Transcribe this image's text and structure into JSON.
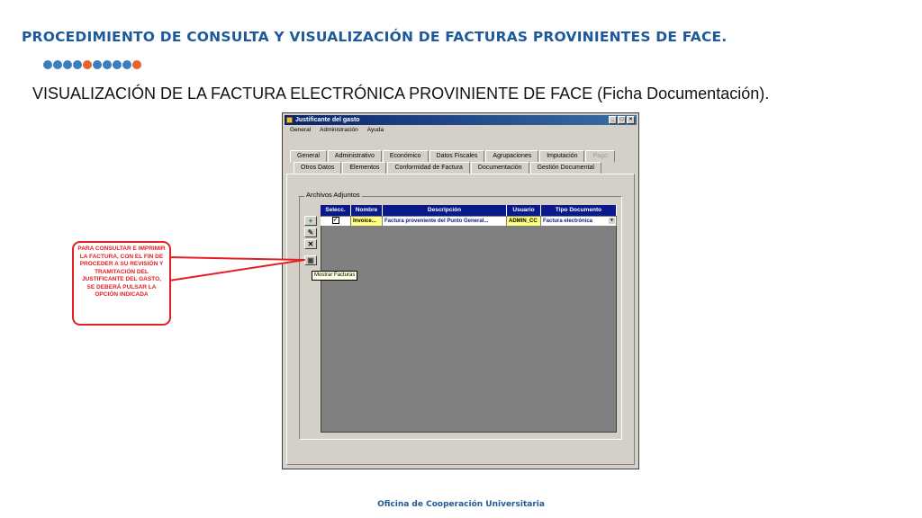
{
  "slide": {
    "title": "PROCEDIMIENTO DE CONSULTA Y VISUALIZACIÓN DE FACTURAS PROVINIENTES DE FACE.",
    "subtitle": "VISUALIZACIÓN DE LA FACTURA ELECTRÓNICA PROVINIENTE DE FACE (Ficha Documentación).",
    "footer": "Oficina de Cooperación Universitaria",
    "dot_colors": [
      "#3a7ec0",
      "#3a7ec0",
      "#3a7ec0",
      "#3a7ec0",
      "#e8622c",
      "#3a7ec0",
      "#3a7ec0",
      "#3a7ec0",
      "#3a7ec0",
      "#e8622c"
    ]
  },
  "window": {
    "title": "Justificante del gasto",
    "controls": [
      "_",
      "□",
      "×"
    ],
    "menu": [
      "General",
      "Administración",
      "Ayuda"
    ],
    "tabs_row1": [
      "General",
      "Administrativo",
      "Económico",
      "Datos Fiscales",
      "Agrupaciones",
      "Imputación",
      "Pago"
    ],
    "tabs_row2": [
      "Otros Datos",
      "Elementos",
      "Conformidad de Factura",
      "Documentación",
      "Gestión Documental"
    ],
    "active_tab": "Documentación",
    "group_label": "Archivos Adjuntos",
    "grid": {
      "columns": [
        "Selecc.",
        "Nombre",
        "Descripción",
        "Usuario",
        "Tipo Documento"
      ],
      "rows": [
        {
          "selected": "✓",
          "nombre": "Invoice...",
          "descripcion": "Factura proveniente del Punto General...",
          "usuario": "ADMIN_CC",
          "tipo": "Factura electrónica"
        }
      ]
    },
    "side_buttons": [
      "+",
      "✎",
      "✕",
      "▣"
    ],
    "tooltip": "Mostrar Facturas"
  },
  "callout": {
    "text": "PARA CONSULTAR E IMPRIMIR LA FACTURA, CON EL FIN DE PROCEDER A SU REVISIÓN Y TRAMITACIÓN DEL JUSTIFICANTE DEL GASTO, SE DEBERÁ PULSAR LA OPCIÓN INDICADA",
    "color": "#e31e24"
  }
}
